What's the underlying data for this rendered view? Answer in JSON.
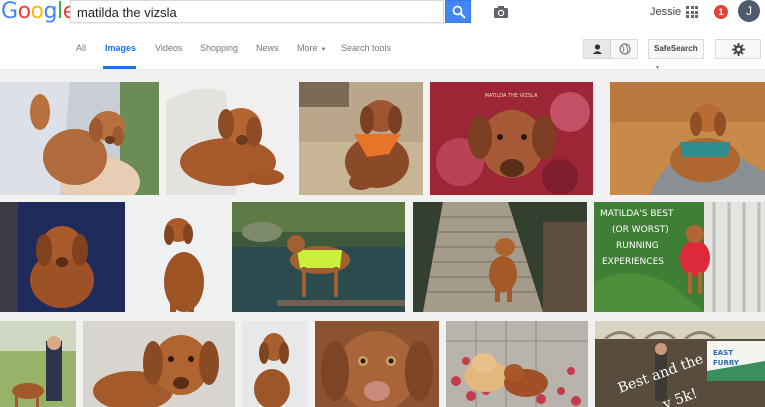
{
  "logo": [
    "G",
    "o",
    "o",
    "g",
    "l",
    "e"
  ],
  "logo_colors": [
    "#4285f4",
    "#ea4335",
    "#fbbc05",
    "#4285f4",
    "#34a853",
    "#ea4335"
  ],
  "search": {
    "query": "matilda the vizsla"
  },
  "user": {
    "name": "Jessie",
    "notifications": "1",
    "initial": "J"
  },
  "tabs": [
    {
      "label": "All"
    },
    {
      "label": "Images",
      "active": true
    },
    {
      "label": "Videos"
    },
    {
      "label": "Shopping"
    },
    {
      "label": "News"
    },
    {
      "label": "More"
    },
    {
      "label": "Search tools"
    }
  ],
  "safesearch_label": "SafeSearch",
  "accent": "#1a73e8",
  "results": {
    "row1_caption": "MATILDA THE VIZSLA",
    "card_text": [
      "MATILDA'S BEST",
      "(OR WORST)",
      "RUNNING",
      "EXPERIENCES"
    ],
    "sign_text": [
      "EAST",
      "FURRY"
    ],
    "overlay_text": [
      "Best and the",
      "y 5k!"
    ]
  }
}
